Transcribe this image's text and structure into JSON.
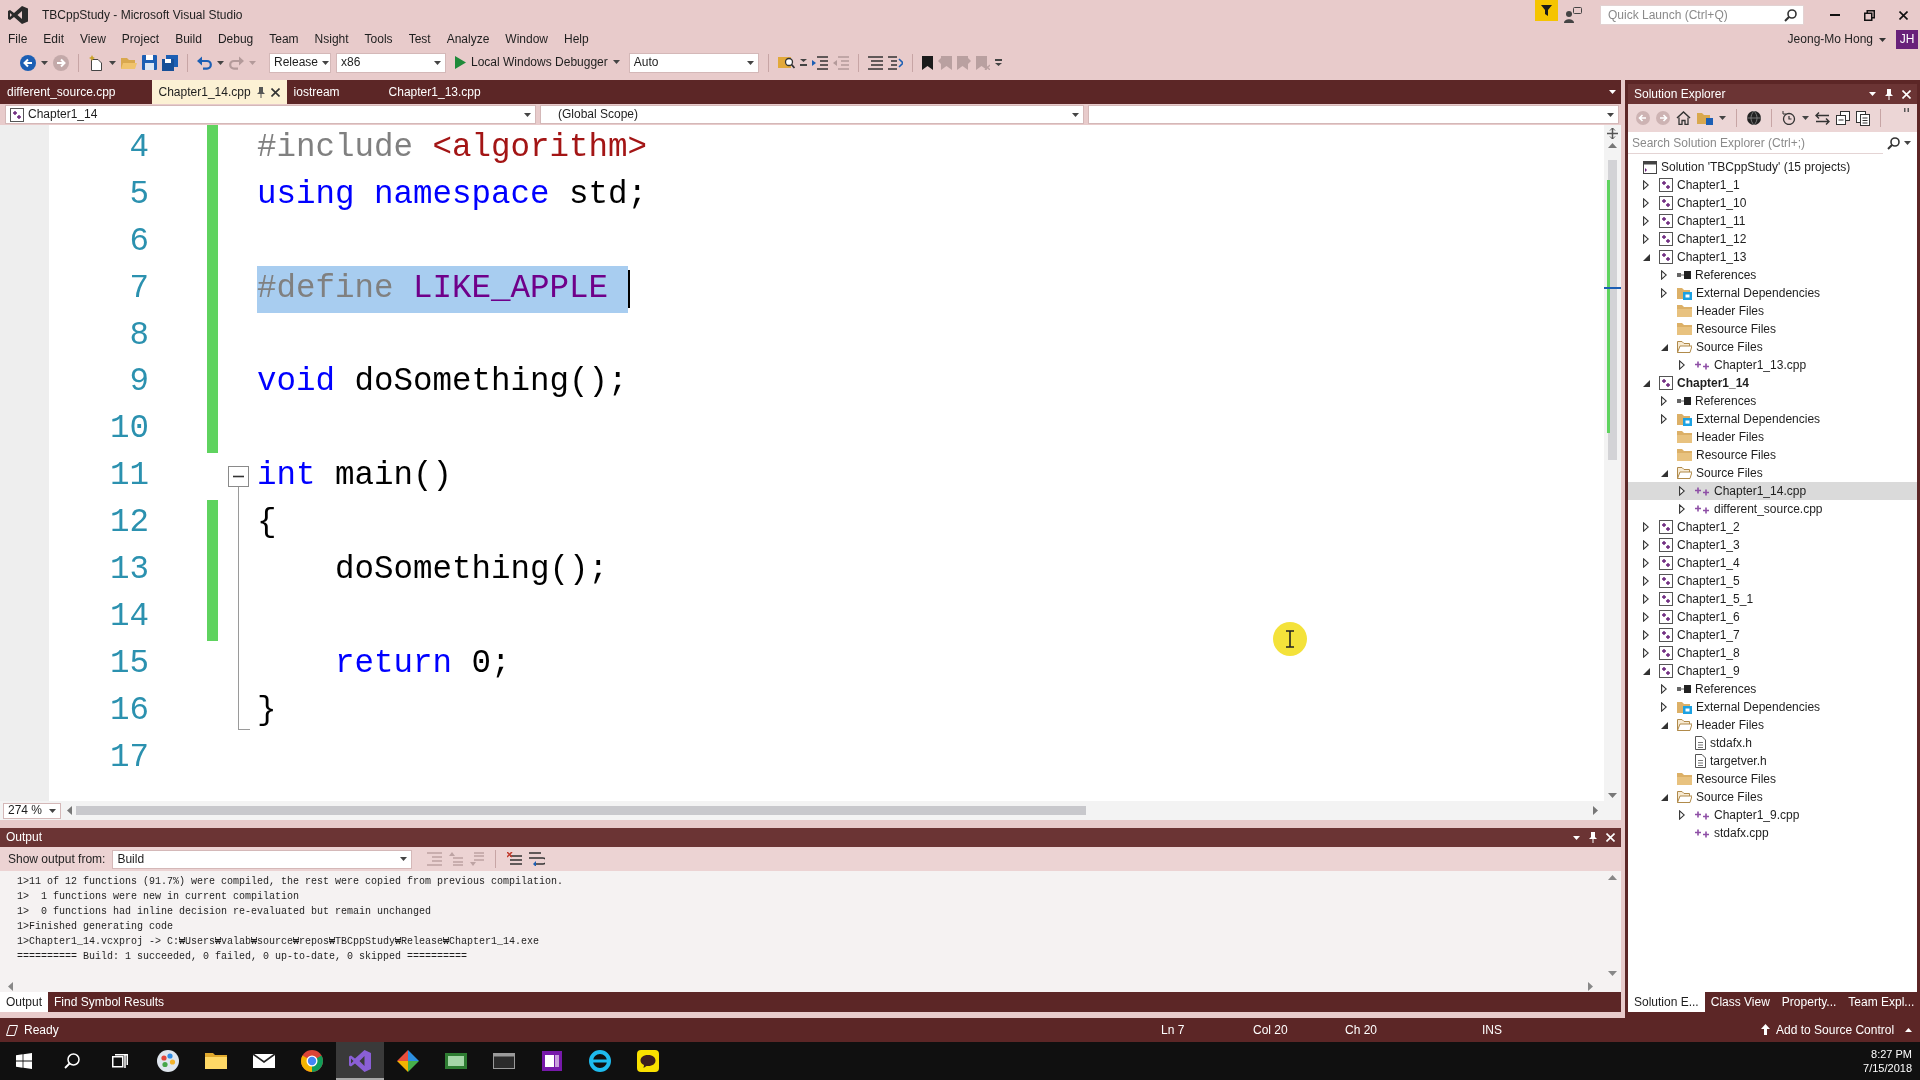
{
  "window": {
    "title": "TBCppStudy - Microsoft Visual Studio"
  },
  "title_bar": {
    "quick_launch": {
      "placeholder": "Quick Launch (Ctrl+Q)"
    },
    "user": {
      "name": "Jeong-Mo Hong",
      "initials": "JH"
    }
  },
  "menu": [
    "File",
    "Edit",
    "View",
    "Project",
    "Build",
    "Debug",
    "Team",
    "Nsight",
    "Tools",
    "Test",
    "Analyze",
    "Window",
    "Help"
  ],
  "toolbar": {
    "configuration": "Release",
    "platform": "x86",
    "debugger": "Local Windows Debugger",
    "mode": "Auto"
  },
  "document_tabs": [
    {
      "label": "different_source.cpp",
      "selected": false
    },
    {
      "label": "Chapter1_14.cpp",
      "selected": true
    },
    {
      "label": "iostream",
      "selected": false
    },
    {
      "label": "Chapter1_13.cpp",
      "selected": false
    }
  ],
  "navigation_bar": {
    "project": "Chapter1_14",
    "scope": "(Global Scope)"
  },
  "editor": {
    "lines": [
      {
        "number": "4",
        "kind": "plain",
        "changed": true,
        "selected": false,
        "tokens": [
          {
            "kind": "preprocessor",
            "text": "#include"
          },
          {
            "kind": "string",
            "text": " <algorithm>"
          }
        ]
      },
      {
        "number": "5",
        "kind": "plain",
        "changed": true,
        "selected": false,
        "tokens": [
          {
            "kind": "keyword",
            "text": "using namespace"
          },
          {
            "kind": "plain",
            "text": " std;"
          }
        ]
      },
      {
        "number": "6",
        "kind": "plain",
        "changed": true,
        "selected": false
      },
      {
        "number": "7",
        "kind": "plain",
        "changed": true,
        "selected": true,
        "tokens": [
          {
            "kind": "preprocessor",
            "text": "#define"
          },
          {
            "kind": "macro",
            "text": " LIKE_APPLE"
          }
        ]
      },
      {
        "number": "8",
        "kind": "plain",
        "changed": true,
        "selected": false
      },
      {
        "number": "9",
        "kind": "plain",
        "changed": true,
        "selected": false,
        "tokens": [
          {
            "kind": "keyword",
            "text": "void"
          },
          {
            "kind": "plain",
            "text": " doSomething();"
          }
        ]
      },
      {
        "number": "10",
        "kind": "plain",
        "changed": true,
        "selected": false
      },
      {
        "number": "11",
        "kind": "opener",
        "changed": false,
        "selected": false,
        "tokens": [
          {
            "kind": "keyword",
            "text": "int"
          },
          {
            "kind": "plain",
            "text": " main()"
          }
        ]
      },
      {
        "number": "12",
        "kind": "body",
        "changed": true,
        "selected": false,
        "tokens": [
          {
            "kind": "plain",
            "text": "{"
          }
        ]
      },
      {
        "number": "13",
        "kind": "body",
        "changed": true,
        "selected": false,
        "tokens": [
          {
            "kind": "plain",
            "text": "    doSomething();"
          }
        ]
      },
      {
        "number": "14",
        "kind": "body",
        "changed": true,
        "selected": false
      },
      {
        "number": "15",
        "kind": "body",
        "changed": false,
        "selected": false,
        "tokens": [
          {
            "kind": "keyword",
            "text": "    return"
          },
          {
            "kind": "plain",
            "text": " 0;"
          }
        ]
      },
      {
        "number": "16",
        "kind": "closer",
        "changed": false,
        "selected": false,
        "tokens": [
          {
            "kind": "plain",
            "text": "}"
          }
        ]
      },
      {
        "number": "17",
        "kind": "plain",
        "changed": false,
        "selected": false
      }
    ],
    "zoom": "274 %"
  },
  "output": {
    "title": "Output",
    "source_label": "Show output from:",
    "source": "Build",
    "lines": [
      "1>11 of 12 functions (91.7%) were compiled, the rest were copied from previous compilation.",
      "1>  1 functions were new in current compilation",
      "1>  0 functions had inline decision re-evaluated but remain unchanged",
      "1>Finished generating code",
      "1>Chapter1_14.vcxproj -> C:₩Users₩valab₩source₩repos₩TBCppStudy₩Release₩Chapter1_14.exe",
      "========== Build: 1 succeeded, 0 failed, 0 up-to-date, 0 skipped =========="
    ],
    "tabs": [
      {
        "label": "Output",
        "selected": true
      },
      {
        "label": "Find Symbol Results",
        "selected": false
      }
    ]
  },
  "solution_explorer": {
    "title": "Solution Explorer",
    "search": {
      "placeholder": "Search Solution Explorer (Ctrl+;)"
    },
    "solution": {
      "label": "Solution 'TBCppStudy' (15 projects)",
      "selected": false
    },
    "projects": [
      {
        "label": "Chapter1_1",
        "kind": "project",
        "expanded": false,
        "startup": false,
        "selected": false
      },
      {
        "label": "Chapter1_10",
        "kind": "project",
        "expanded": false,
        "startup": false,
        "selected": false
      },
      {
        "label": "Chapter1_11",
        "kind": "project",
        "expanded": false,
        "startup": false,
        "selected": false
      },
      {
        "label": "Chapter1_12",
        "kind": "project",
        "expanded": false,
        "startup": false,
        "selected": false
      },
      {
        "label": "Chapter1_13",
        "kind": "project",
        "expanded": true,
        "startup": false,
        "selected": false,
        "children": [
          {
            "label": "References",
            "kind": "references",
            "expanded": false,
            "selected": false
          },
          {
            "label": "External Dependencies",
            "kind": "external",
            "expanded": false,
            "selected": false
          },
          {
            "label": "Header Files",
            "kind": "folder",
            "selected": false
          },
          {
            "label": "Resource Files",
            "kind": "folder",
            "selected": false
          },
          {
            "label": "Source Files",
            "kind": "folder",
            "expanded": true,
            "selected": false,
            "children": [
              {
                "label": "Chapter1_13.cpp",
                "kind": "source",
                "expanded": false,
                "selected": false
              }
            ]
          }
        ]
      },
      {
        "label": "Chapter1_14",
        "kind": "project",
        "expanded": true,
        "startup": true,
        "selected": false,
        "children": [
          {
            "label": "References",
            "kind": "references",
            "expanded": false,
            "selected": false
          },
          {
            "label": "External Dependencies",
            "kind": "external",
            "expanded": false,
            "selected": false
          },
          {
            "label": "Header Files",
            "kind": "folder",
            "selected": false
          },
          {
            "label": "Resource Files",
            "kind": "folder",
            "selected": false
          },
          {
            "label": "Source Files",
            "kind": "folder",
            "expanded": true,
            "selected": false,
            "children": [
              {
                "label": "Chapter1_14.cpp",
                "kind": "source",
                "expanded": false,
                "selected": true
              },
              {
                "label": "different_source.cpp",
                "kind": "source",
                "expanded": false,
                "selected": false
              }
            ]
          }
        ]
      },
      {
        "label": "Chapter1_2",
        "kind": "project",
        "expanded": false,
        "startup": false,
        "selected": false
      },
      {
        "label": "Chapter1_3",
        "kind": "project",
        "expanded": false,
        "startup": false,
        "selected": false
      },
      {
        "label": "Chapter1_4",
        "kind": "project",
        "expanded": false,
        "startup": false,
        "selected": false
      },
      {
        "label": "Chapter1_5",
        "kind": "project",
        "expanded": false,
        "startup": false,
        "selected": false
      },
      {
        "label": "Chapter1_5_1",
        "kind": "project",
        "expanded": false,
        "startup": false,
        "selected": false
      },
      {
        "label": "Chapter1_6",
        "kind": "project",
        "expanded": false,
        "startup": false,
        "selected": false
      },
      {
        "label": "Chapter1_7",
        "kind": "project",
        "expanded": false,
        "startup": false,
        "selected": false
      },
      {
        "label": "Chapter1_8",
        "kind": "project",
        "expanded": false,
        "startup": false,
        "selected": false
      },
      {
        "label": "Chapter1_9",
        "kind": "project",
        "expanded": true,
        "startup": false,
        "selected": false,
        "children": [
          {
            "label": "References",
            "kind": "references",
            "expanded": false,
            "selected": false
          },
          {
            "label": "External Dependencies",
            "kind": "external",
            "expanded": false,
            "selected": false
          },
          {
            "label": "Header Files",
            "kind": "folder",
            "expanded": true,
            "selected": false,
            "children": [
              {
                "label": "stdafx.h",
                "kind": "header",
                "selected": false
              },
              {
                "label": "targetver.h",
                "kind": "header",
                "selected": false
              }
            ]
          },
          {
            "label": "Resource Files",
            "kind": "folder",
            "selected": false
          },
          {
            "label": "Source Files",
            "kind": "folder",
            "expanded": true,
            "selected": false,
            "children": [
              {
                "label": "Chapter1_9.cpp",
                "kind": "source",
                "expanded": false,
                "selected": false
              },
              {
                "label": "stdafx.cpp",
                "kind": "source",
                "selected": false
              }
            ]
          }
        ]
      }
    ],
    "tabs": [
      {
        "label": "Solution E...",
        "selected": true
      },
      {
        "label": "Class View",
        "selected": false
      },
      {
        "label": "Property...",
        "selected": false
      },
      {
        "label": "Team Expl...",
        "selected": false
      }
    ]
  },
  "status_bar": {
    "message": "Ready",
    "line": "Ln 7",
    "column": "Col 20",
    "char": "Ch 20",
    "mode": "INS",
    "source_control": "Add to Source Control"
  },
  "taskbar": {
    "apps": [
      {
        "kind": "paint",
        "selected": false
      },
      {
        "kind": "explorer",
        "selected": false
      },
      {
        "kind": "mail",
        "selected": false
      },
      {
        "kind": "browser",
        "selected": false
      },
      {
        "kind": "studio",
        "selected": true
      },
      {
        "kind": "git",
        "selected": false
      },
      {
        "kind": "monitor",
        "selected": false
      },
      {
        "kind": "terminal",
        "selected": false
      },
      {
        "kind": "notes",
        "selected": false
      },
      {
        "kind": "web",
        "selected": false
      },
      {
        "kind": "chat",
        "selected": false
      }
    ],
    "time": "8:27 PM",
    "date": "7/15/2018"
  }
}
